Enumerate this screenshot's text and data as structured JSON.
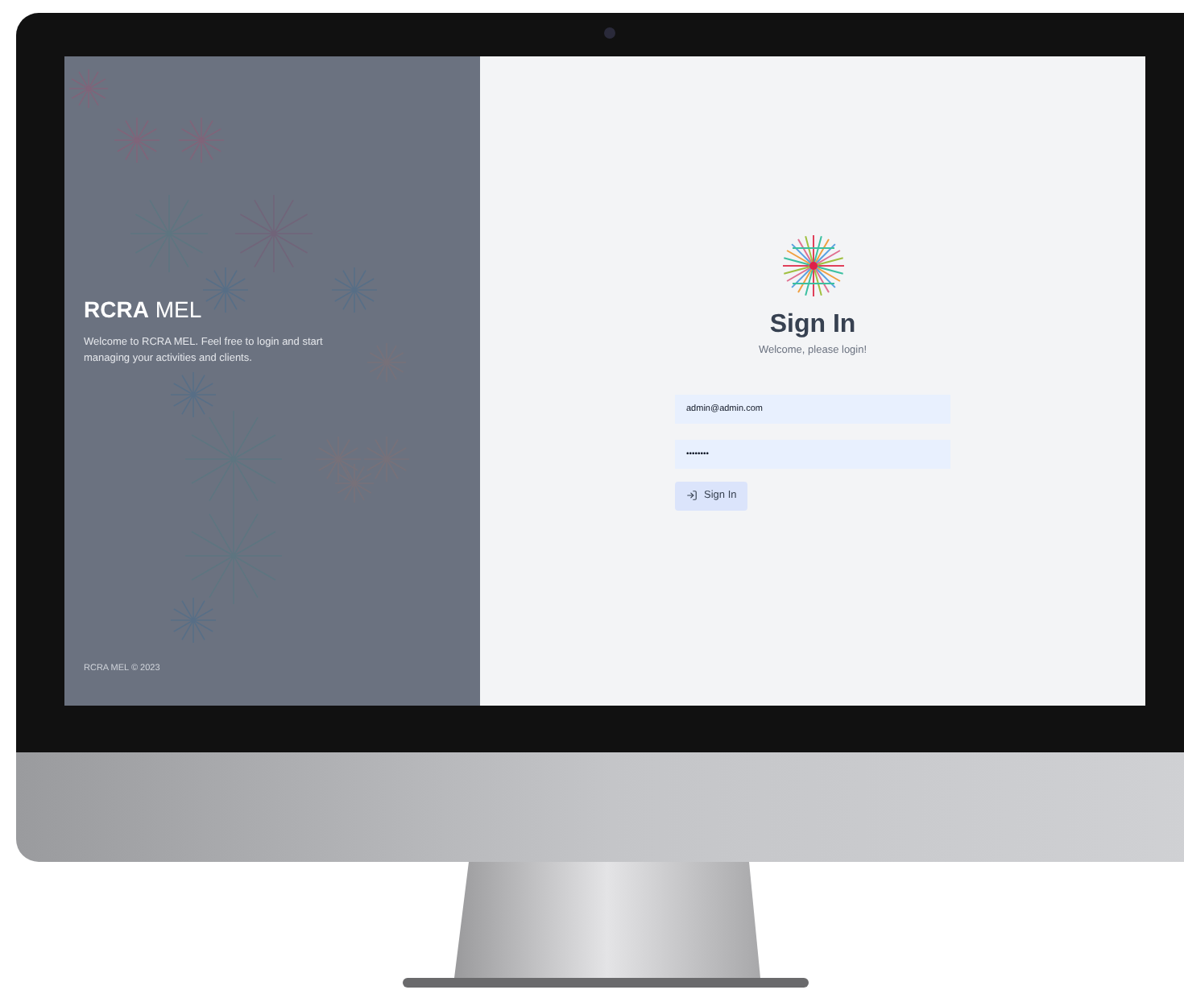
{
  "brand_panel": {
    "title": "**RCRA** MEL",
    "description": "Welcome to RCRA MEL. Feel free to login and start managing your activities and clients.",
    "footer": "RCRA MEL © 2023"
  },
  "sign_in": {
    "heading": "Sign In",
    "subtitle": "Welcome, please login!",
    "email": {
      "value": "admin@admin.com"
    },
    "password": {
      "value": "••••••••"
    },
    "button": "Sign In"
  }
}
